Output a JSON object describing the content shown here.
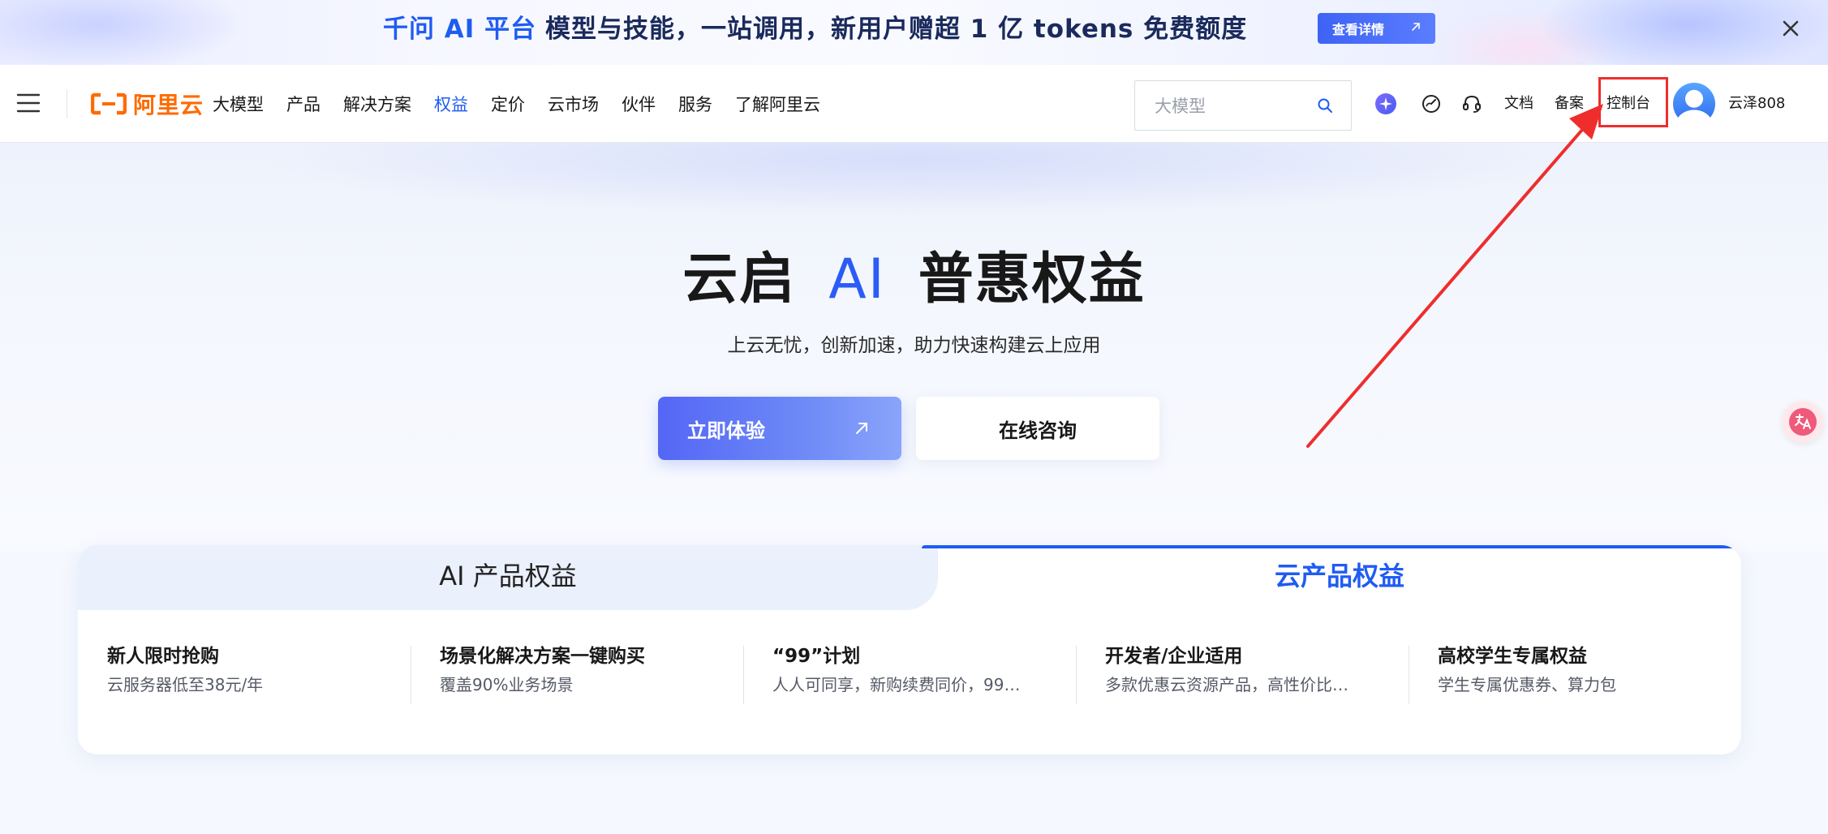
{
  "banner": {
    "brand": "千问 AI 平台",
    "text": "模型与技能，一站调用，新用户赠超 1 亿 tokens 免费额度",
    "cta_label": "查看详情",
    "close_icon": "close-icon"
  },
  "navbar": {
    "logo_text": "阿里云",
    "items": [
      "大模型",
      "产品",
      "解决方案",
      "权益",
      "定价",
      "云市场",
      "伙伴",
      "服务",
      "了解阿里云"
    ],
    "active_item": "权益",
    "search_placeholder": "大模型",
    "links": {
      "docs": "文档",
      "filing": "备案",
      "console": "控制台"
    },
    "username": "云泽808",
    "icons": [
      "sparkle-icon",
      "speedometer-icon",
      "headset-icon",
      "search-icon",
      "menu-icon"
    ]
  },
  "hero": {
    "title_part1": "云启",
    "title_ai": "AI",
    "title_part2": "普惠权益",
    "subtitle": "上云无忧，创新加速，助力快速构建云上应用",
    "primary_button": "立即体验",
    "secondary_button": "在线咨询"
  },
  "panel": {
    "tabs": [
      {
        "label": "AI 产品权益",
        "active": false
      },
      {
        "label": "云产品权益",
        "active": true
      }
    ],
    "features": [
      {
        "title": "新人限时抢购",
        "desc": "云服务器低至38元/年"
      },
      {
        "title": "场景化解决方案一键购买",
        "desc": "覆盖90%业务场景"
      },
      {
        "title": "“99”计划",
        "desc": "人人可同享，新购续费同价，99…"
      },
      {
        "title": "开发者/企业适用",
        "desc": "多款优惠云资源产品，高性价比…"
      },
      {
        "title": "高校学生专属权益",
        "desc": "学生专属优惠券、算力包"
      }
    ]
  },
  "colors": {
    "brand_orange": "#ff6a00",
    "accent_blue": "#1f5cf2",
    "annotation_red": "#ef2d2d"
  }
}
